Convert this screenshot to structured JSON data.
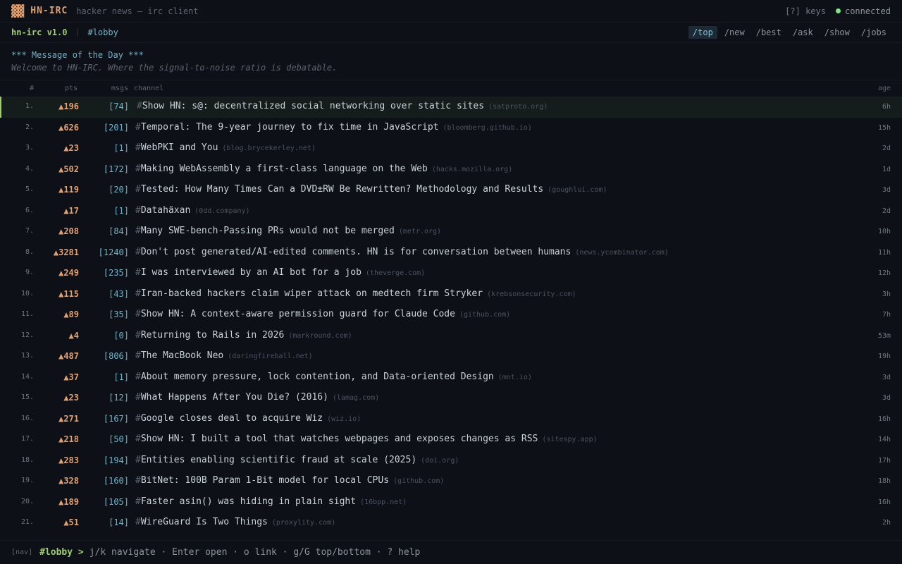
{
  "titlebar": {
    "logo": "▓▓",
    "app_name": "HN-IRC",
    "subtitle": "hacker news — irc client",
    "keys_label": "[?] keys",
    "status": "connected",
    "status_color": "#7ee787"
  },
  "chanbar": {
    "version": "hn-irc v1.0",
    "channel": "#lobby",
    "feeds": [
      "/top",
      "/new",
      "/best",
      "/ask",
      "/show",
      "/jobs"
    ],
    "active_feed": "/top"
  },
  "motd": {
    "title": "*** Message of the Day ***",
    "text": "Welcome to HN-IRC. Where the signal-to-noise ratio is debatable."
  },
  "table": {
    "headers": {
      "idx": "#",
      "pts": "pts",
      "msgs": "msgs",
      "channel": "channel",
      "age": "age"
    },
    "selected_index": 0,
    "rows": [
      {
        "idx": "1.",
        "pts": "▲196",
        "msgs": "[74]",
        "title": "Show HN: s@: decentralized social networking over static sites",
        "domain": "(satproto.org)",
        "age": "6h"
      },
      {
        "idx": "2.",
        "pts": "▲626",
        "msgs": "[201]",
        "title": "Temporal: The 9-year journey to fix time in JavaScript",
        "domain": "(bloomberg.github.io)",
        "age": "15h"
      },
      {
        "idx": "3.",
        "pts": "▲23",
        "msgs": "[1]",
        "title": "WebPKI and You",
        "domain": "(blog.brycekerley.net)",
        "age": "2d"
      },
      {
        "idx": "4.",
        "pts": "▲502",
        "msgs": "[172]",
        "title": "Making WebAssembly a first-class language on the Web",
        "domain": "(hacks.mozilla.org)",
        "age": "1d"
      },
      {
        "idx": "5.",
        "pts": "▲119",
        "msgs": "[20]",
        "title": "Tested: How Many Times Can a DVD±RW Be Rewritten? Methodology and Results",
        "domain": "(goughlui.com)",
        "age": "3d"
      },
      {
        "idx": "6.",
        "pts": "▲17",
        "msgs": "[1]",
        "title": "Datahäxan",
        "domain": "(0dd.company)",
        "age": "2d"
      },
      {
        "idx": "7.",
        "pts": "▲208",
        "msgs": "[84]",
        "title": "Many SWE-bench-Passing PRs would not be merged",
        "domain": "(metr.org)",
        "age": "10h"
      },
      {
        "idx": "8.",
        "pts": "▲3281",
        "msgs": "[1240]",
        "title": "Don't post generated/AI-edited comments. HN is for conversation between humans",
        "domain": "(news.ycombinator.com)",
        "age": "11h"
      },
      {
        "idx": "9.",
        "pts": "▲249",
        "msgs": "[235]",
        "title": "I was interviewed by an AI bot for a job",
        "domain": "(theverge.com)",
        "age": "12h"
      },
      {
        "idx": "10.",
        "pts": "▲115",
        "msgs": "[43]",
        "title": "Iran-backed hackers claim wiper attack on medtech firm Stryker",
        "domain": "(krebsonsecurity.com)",
        "age": "3h"
      },
      {
        "idx": "11.",
        "pts": "▲89",
        "msgs": "[35]",
        "title": "Show HN: A context-aware permission guard for Claude Code",
        "domain": "(github.com)",
        "age": "7h"
      },
      {
        "idx": "12.",
        "pts": "▲4",
        "msgs": "[0]",
        "title": "Returning to Rails in 2026",
        "domain": "(markround.com)",
        "age": "53m"
      },
      {
        "idx": "13.",
        "pts": "▲487",
        "msgs": "[806]",
        "title": "The MacBook Neo",
        "domain": "(daringfireball.net)",
        "age": "19h"
      },
      {
        "idx": "14.",
        "pts": "▲37",
        "msgs": "[1]",
        "title": "About memory pressure, lock contention, and Data-oriented Design",
        "domain": "(mnt.io)",
        "age": "3d"
      },
      {
        "idx": "15.",
        "pts": "▲23",
        "msgs": "[12]",
        "title": "What Happens After You Die? (2016)",
        "domain": "(lamag.com)",
        "age": "3d"
      },
      {
        "idx": "16.",
        "pts": "▲271",
        "msgs": "[167]",
        "title": "Google closes deal to acquire Wiz",
        "domain": "(wiz.io)",
        "age": "16h"
      },
      {
        "idx": "17.",
        "pts": "▲218",
        "msgs": "[50]",
        "title": "Show HN: I built a tool that watches webpages and exposes changes as RSS",
        "domain": "(sitespy.app)",
        "age": "14h"
      },
      {
        "idx": "18.",
        "pts": "▲283",
        "msgs": "[194]",
        "title": "Entities enabling scientific fraud at scale (2025)",
        "domain": "(doi.org)",
        "age": "17h"
      },
      {
        "idx": "19.",
        "pts": "▲328",
        "msgs": "[160]",
        "title": "BitNet: 100B Param 1-Bit model for local CPUs",
        "domain": "(github.com)",
        "age": "18h"
      },
      {
        "idx": "20.",
        "pts": "▲189",
        "msgs": "[105]",
        "title": "Faster asin() was hiding in plain sight",
        "domain": "(16bpp.net)",
        "age": "16h"
      },
      {
        "idx": "21.",
        "pts": "▲51",
        "msgs": "[14]",
        "title": "WireGuard Is Two Things",
        "domain": "(proxylity.com)",
        "age": "2h"
      }
    ]
  },
  "cmdline": {
    "mode": "[nav]",
    "prompt": "#lobby >",
    "hints": "j/k navigate · Enter open · o link · g/G top/bottom · ? help"
  },
  "colors": {
    "accent": "#e0a070",
    "channel": "#6fb3c9",
    "prompt": "#9ece6a",
    "background": "#0d1117"
  }
}
